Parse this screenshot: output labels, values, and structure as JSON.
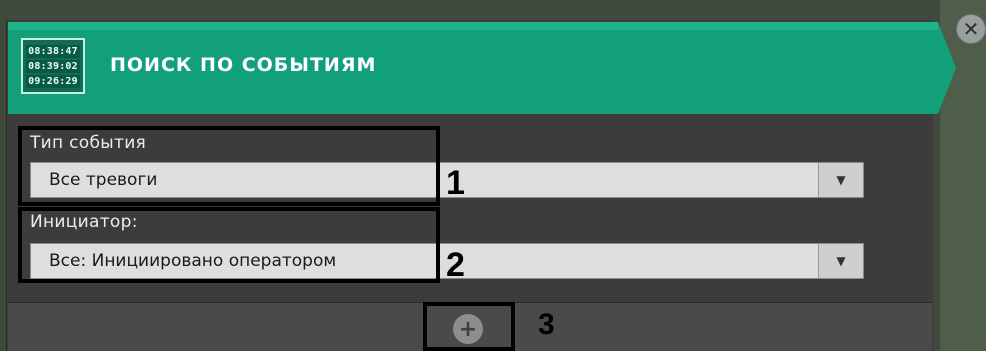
{
  "header": {
    "title": "ПОИСК ПО СОБЫТИЯМ",
    "icon_name": "event-clock-icon",
    "icon_times": [
      "08:38:47",
      "08:39:02",
      "09:26:29"
    ],
    "accent": "#12a07a"
  },
  "close_icon_glyph": "✕",
  "fields": {
    "event_type": {
      "label": "Тип события",
      "value": "Все тревоги"
    },
    "initiator": {
      "label": "Инициатор:",
      "value": "Все: Инициировано оператором"
    }
  },
  "dropdown_glyph": "▼",
  "add_glyph": "+",
  "annotations": {
    "one": "1",
    "two": "2",
    "three": "3"
  }
}
